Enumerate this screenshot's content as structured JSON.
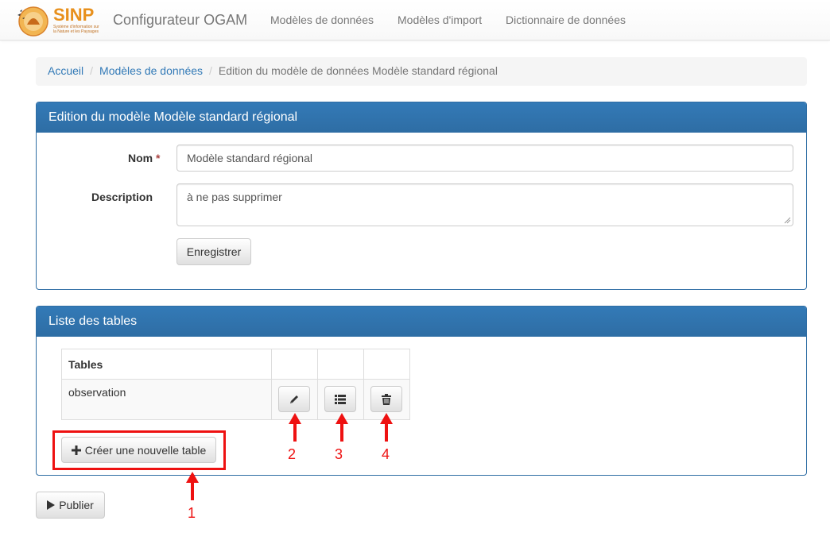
{
  "navbar": {
    "logo_text": "SINP",
    "logo_subtext": "Système d'information sur la Nature et les Paysages",
    "brand": "Configurateur OGAM",
    "links": [
      "Modèles de données",
      "Modèles d'import",
      "Dictionnaire de données"
    ]
  },
  "breadcrumb": {
    "home": "Accueil",
    "models": "Modèles de données",
    "current": "Edition du modèle de données Modèle standard régional"
  },
  "edit_panel": {
    "title": "Edition du modèle Modèle standard régional",
    "name_label": "Nom",
    "required_mark": "*",
    "name_value": "Modèle standard régional",
    "description_label": "Description",
    "description_value": "à ne pas supprimer",
    "save_button": "Enregistrer"
  },
  "tables_panel": {
    "title": "Liste des tables",
    "column_header": "Tables",
    "rows": [
      {
        "name": "observation"
      }
    ],
    "create_button": "Créer une nouvelle table"
  },
  "publish_button": "Publier",
  "annotations": [
    "1",
    "2",
    "3",
    "4"
  ],
  "colors": {
    "primary": "#337ab7",
    "annotation": "#ee1111",
    "logo": "#e8901c"
  }
}
